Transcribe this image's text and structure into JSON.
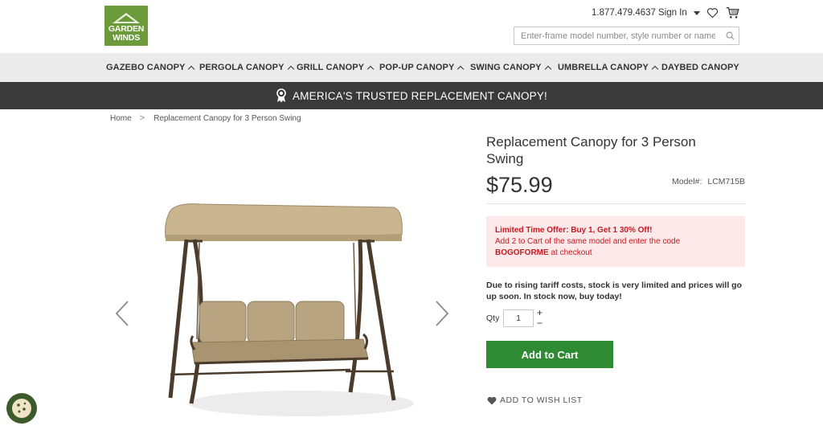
{
  "brand": {
    "logo_line1": "GARDEN",
    "logo_line2": "WINDS"
  },
  "header": {
    "phone": "1.877.479.4637",
    "sign_in": "Sign In",
    "search_placeholder": "Enter-frame model number, style number or name"
  },
  "nav": {
    "items": [
      {
        "label": "GAZEBO CANOPY",
        "has_menu": true
      },
      {
        "label": "PERGOLA CANOPY",
        "has_menu": true
      },
      {
        "label": "GRILL CANOPY",
        "has_menu": true
      },
      {
        "label": "POP-UP CANOPY",
        "has_menu": true
      },
      {
        "label": "SWING CANOPY",
        "has_menu": true
      },
      {
        "label": "UMBRELLA CANOPY",
        "has_menu": true
      },
      {
        "label": "DAYBED CANOPY",
        "has_menu": false
      }
    ]
  },
  "banner": {
    "text": "AMERICA'S TRUSTED REPLACEMENT CANOPY!",
    "icon": "award-ribbon-icon"
  },
  "breadcrumb": {
    "home": "Home",
    "separator": ">",
    "current": "Replacement Canopy for 3 Person Swing"
  },
  "product": {
    "title": "Replacement Canopy for 3 Person Swing",
    "price": "$75.99",
    "model_label": "Model#:",
    "model_value": "LCM715B",
    "offer": {
      "title": "Limited Time Offer: Buy 1, Get 1 30% Off!",
      "line2": "Add 2 to Cart of the same model and enter the code",
      "code": "BOGOFORME",
      "line3_suffix": " at checkout"
    },
    "tariff_notice": "Due to rising tariff costs, stock is very limited and prices will go up soon. In stock now, buy today!",
    "qty_label": "Qty",
    "qty_value": "1",
    "qty_plus": "+",
    "qty_minus": "−",
    "add_to_cart": "Add to Cart",
    "wishlist": "ADD TO WISH LIST"
  },
  "colors": {
    "accent_green": "#2f8a34",
    "banner_dark": "#3a3a3a",
    "offer_bg": "#fde9ea",
    "offer_text": "#c8191f",
    "canopy_tan": "#c9b590",
    "frame_brown": "#4a3b2c"
  }
}
